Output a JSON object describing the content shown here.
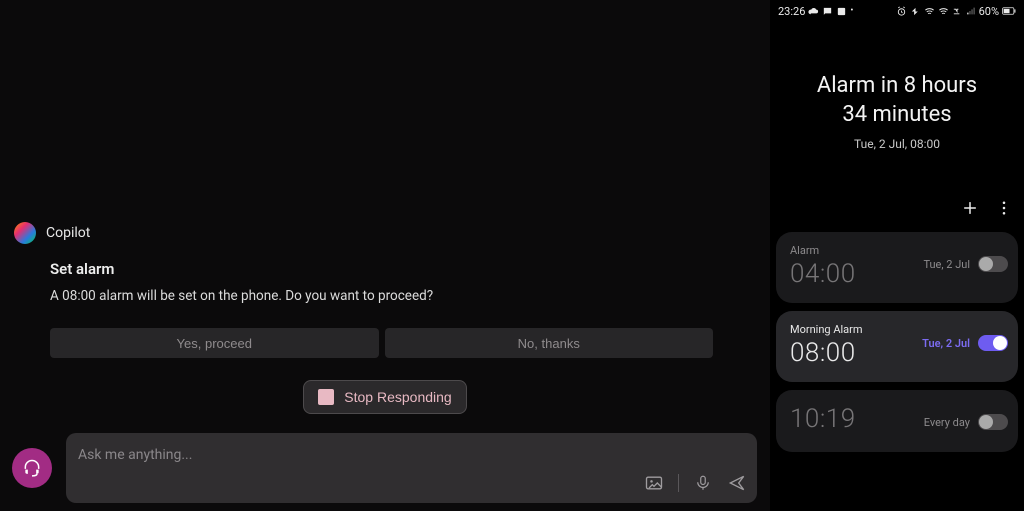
{
  "copilot": {
    "label": "Copilot",
    "card_title": "Set alarm",
    "card_text": "A 08:00 alarm will be set on the phone. Do you want to proceed?",
    "yes_label": "Yes, proceed",
    "no_label": "No, thanks",
    "stop_label": "Stop Responding",
    "input_placeholder": "Ask me anything..."
  },
  "phone": {
    "status_time": "23:26",
    "battery_text": "60%",
    "hero_line1": "Alarm in 8 hours",
    "hero_line2": "34 minutes",
    "hero_sub": "Tue, 2 Jul, 08:00",
    "alarms": [
      {
        "label": "Alarm",
        "time": "04:00",
        "day": "Tue, 2 Jul",
        "on": false,
        "active": false
      },
      {
        "label": "Morning Alarm",
        "time": "08:00",
        "day": "Tue, 2 Jul",
        "on": true,
        "active": true
      },
      {
        "label": "",
        "time": "10:19",
        "day": "Every day",
        "on": false,
        "active": false
      }
    ]
  }
}
